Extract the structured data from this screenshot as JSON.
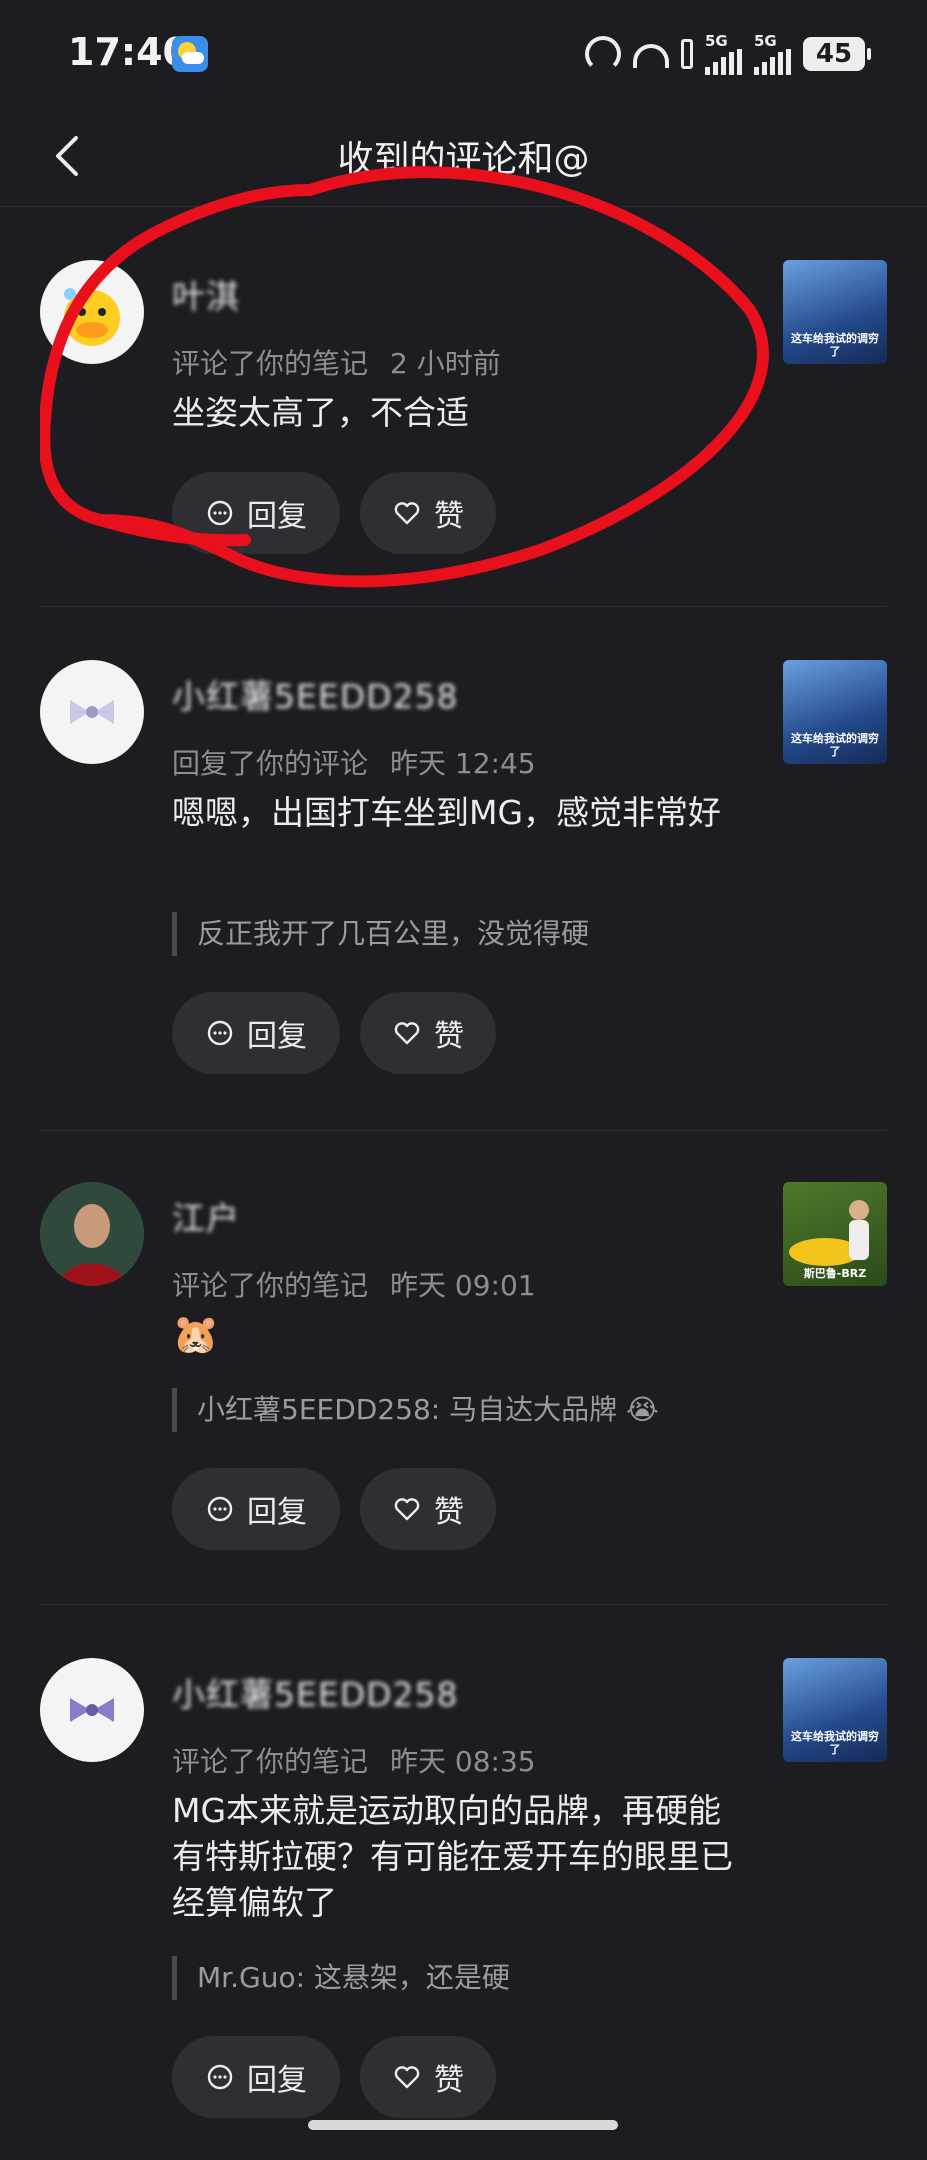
{
  "status_bar": {
    "time": "17:40",
    "signal_1": "5G",
    "signal_2": "5G",
    "battery": "45"
  },
  "header": {
    "title": "收到的评论和@"
  },
  "comments": [
    {
      "username": "叶淇",
      "action": "评论了你的笔记",
      "time": "2 小时前",
      "text": "坐姿太高了，不合适",
      "thumb_caption": "这车给我试的调穷了",
      "reply_label": "回复",
      "like_label": "赞"
    },
    {
      "username": "小红薯5EEDD258",
      "action": "回复了你的评论",
      "time": "昨天 12:45",
      "text": "嗯嗯，出国打车坐到MG，感觉非常好",
      "quote": "反正我开了几百公里，没觉得硬",
      "thumb_caption": "这车给我试的调穷了",
      "reply_label": "回复",
      "like_label": "赞"
    },
    {
      "username": "江户",
      "action": "评论了你的笔记",
      "time": "昨天 09:01",
      "text": "",
      "quote": "小红薯5EEDD258: 马自达大品牌",
      "thumb_caption": "斯巴鲁-BRZ",
      "reply_label": "回复",
      "like_label": "赞"
    },
    {
      "username": "小红薯5EEDD258",
      "action": "评论了你的笔记",
      "time": "昨天 08:35",
      "text": "MG本来就是运动取向的品牌，再硬能有特斯拉硬？有可能在爱开车的眼里已经算偏软了",
      "quote": "Mr.Guo: 这悬架，还是硬",
      "thumb_caption": "这车给我试的调穷了",
      "reply_label": "回复",
      "like_label": "赞"
    }
  ],
  "colors": {
    "background": "#1c1c21",
    "button": "#2e2e33",
    "annotation": "#e8101c"
  }
}
